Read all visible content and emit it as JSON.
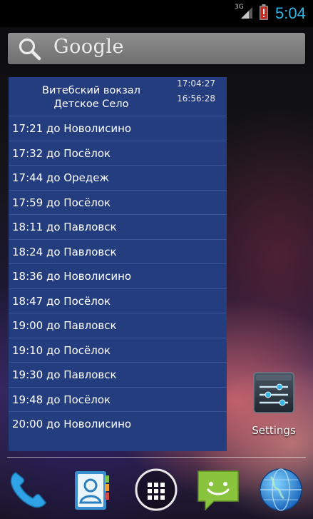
{
  "status_bar": {
    "network_type": "3G",
    "clock": "5:04",
    "clock_color": "#33b5e5",
    "signal_icon": "signal-icon",
    "battery_icon": "battery-alert-icon"
  },
  "search_bar": {
    "label": "Google",
    "icon": "search-icon"
  },
  "widget": {
    "station_from": "Витебский вокзал",
    "station_to": "Детское Село",
    "time_now": "17:04:27",
    "time_updated": "16:56:28",
    "background_color": "#233d7f",
    "trains": [
      "17:21 до Новолисино",
      "17:32 до Посёлок",
      "17:44 до Оредеж",
      "17:59 до Посёлок",
      "18:11 до Павловск",
      "18:24 до Павловск",
      "18:36 до Новолисино",
      "18:47 до Посёлок",
      "19:00 до Павловск",
      "19:10 до Посёлок",
      "19:30 до Павловск",
      "19:48 до Посёлок",
      "20:00 до Новолисино"
    ]
  },
  "shortcuts": {
    "settings_label": "Settings",
    "settings_icon": "settings-sliders-icon"
  },
  "dock": {
    "items": [
      "phone-icon",
      "people-icon",
      "all-apps-icon",
      "messaging-icon",
      "browser-globe-icon"
    ]
  }
}
